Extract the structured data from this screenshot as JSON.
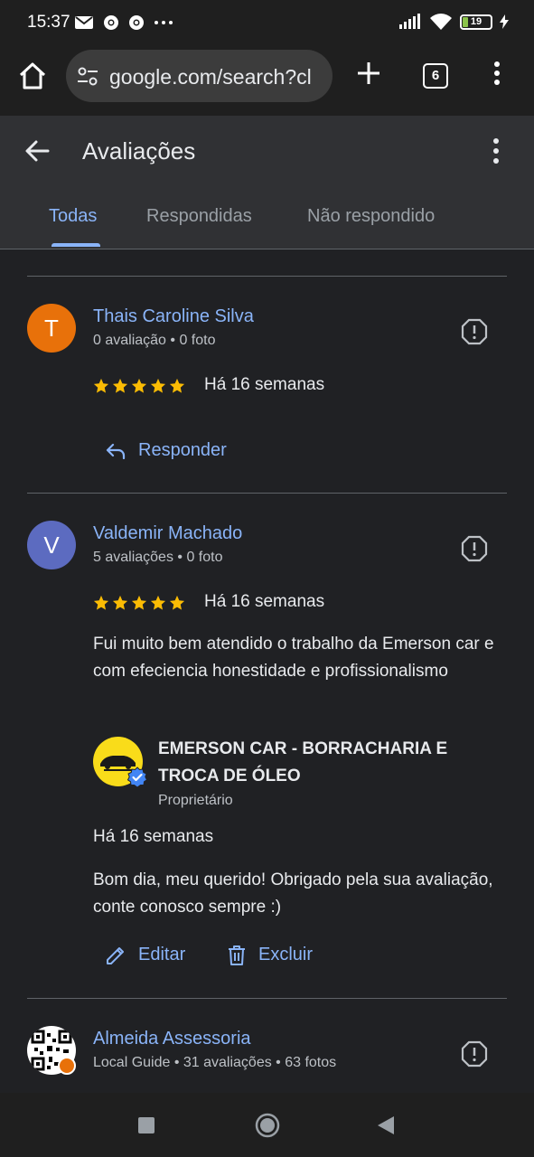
{
  "status_bar": {
    "time": "15:37",
    "battery": "19",
    "colors": {
      "battery_fill": "#8bc34a"
    }
  },
  "browser": {
    "url": "google.com/search?cl",
    "tab_count": "6",
    "icons": [
      "home-icon",
      "tune-icon",
      "plus-icon",
      "more-vert-icon"
    ]
  },
  "header": {
    "title": "Avaliações",
    "tabs": [
      {
        "label": "Todas",
        "active": true
      },
      {
        "label": "Respondidas",
        "active": false
      },
      {
        "label": "Não respondido",
        "active": false
      }
    ]
  },
  "reviews": [
    {
      "avatar_letter": "T",
      "avatar_color": "#e8710a",
      "name": "Thais Caroline Silva",
      "meta": "0 avaliação • 0 foto",
      "rating": 5,
      "date": "Há 16 semanas",
      "text": "",
      "action": "Responder"
    },
    {
      "avatar_letter": "V",
      "avatar_color": "#5c6bc0",
      "name": "Valdemir Machado",
      "meta": "5 avaliações • 0 foto",
      "rating": 5,
      "date": "Há 16 semanas",
      "text": "Fui muito bem atendido o trabalho da Emerson car e com efeciencia honestidade e profissionalismo",
      "owner_reply": {
        "business_name": "EMERSON CAR - BORRACHARIA E TROCA DE ÓLEO",
        "role": "Proprietário",
        "date": "Há 16 semanas",
        "text": "Bom dia, meu querido! Obrigado pela sua avaliação, conte conosco sempre :)",
        "edit_label": "Editar",
        "delete_label": "Excluir"
      }
    },
    {
      "name": "Almeida Assessoria",
      "meta": "Local Guide • 31 avaliações • 63 fotos"
    }
  ],
  "colors": {
    "accent": "#8ab4f8",
    "star": "#fbbc04",
    "background": "#202124",
    "header": "#303134"
  }
}
